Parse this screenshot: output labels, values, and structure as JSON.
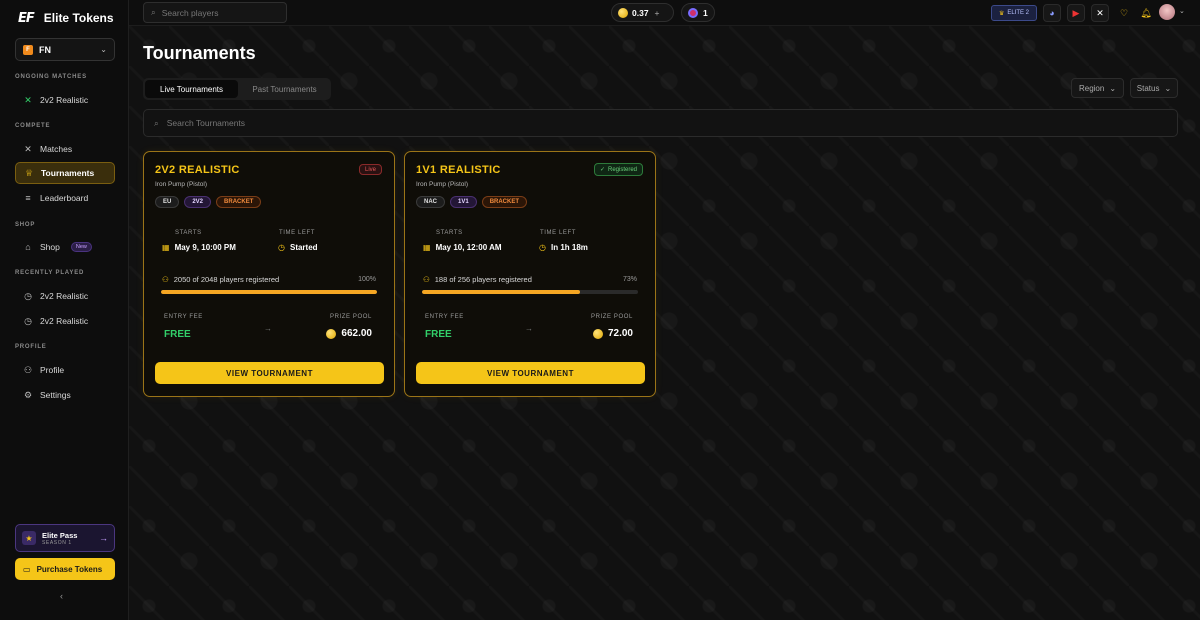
{
  "brand": {
    "logo": "EF",
    "name": "Elite Tokens"
  },
  "game_select": {
    "badge": "FN",
    "label": "FN"
  },
  "sidebar": {
    "sections": {
      "ongoing": "ONGOING MATCHES",
      "compete": "COMPETE",
      "shop": "SHOP",
      "recent": "RECENTLY PLAYED",
      "profile": "PROFILE"
    },
    "ongoing_items": [
      {
        "label": "2v2 Realistic",
        "icon": "crossed-swords-icon"
      }
    ],
    "compete_items": [
      {
        "label": "Matches",
        "icon": "crossed-swords-icon"
      },
      {
        "label": "Tournaments",
        "icon": "trophy-icon"
      },
      {
        "label": "Leaderboard",
        "icon": "list-icon"
      }
    ],
    "shop_item": {
      "label": "Shop",
      "tag": "New",
      "icon": "bag-icon"
    },
    "recent_items": [
      {
        "label": "2v2 Realistic",
        "icon": "clock-icon"
      },
      {
        "label": "2v2 Realistic",
        "icon": "clock-icon"
      }
    ],
    "profile_items": [
      {
        "label": "Profile",
        "icon": "user-icon"
      },
      {
        "label": "Settings",
        "icon": "gear-icon"
      }
    ],
    "elite_pass": {
      "title": "Elite Pass",
      "subtitle": "SEASON 1"
    },
    "purchase_label": "Purchase Tokens"
  },
  "topbar": {
    "search_placeholder": "Search players",
    "coins": "0.37",
    "tokens": "1",
    "elite_badge": "ELITE 2"
  },
  "main": {
    "title": "Tournaments",
    "tabs": [
      "Live Tournaments",
      "Past Tournaments"
    ],
    "filters": [
      "Region",
      "Status"
    ],
    "search_placeholder": "Search Tournaments"
  },
  "tournaments": [
    {
      "title": "2V2 REALISTIC",
      "subtitle": "Iron Pump (Pistol)",
      "status": "Live",
      "chips": [
        "EU",
        "2V2",
        "BRACKET"
      ],
      "starts_label": "STARTS",
      "starts": "May 9, 10:00 PM",
      "time_left_label": "TIME LEFT",
      "time_left": "Started",
      "registered_text": "2050 of 2048 players registered",
      "percent": "100%",
      "fill": 1.0,
      "entry_label": "ENTRY FEE",
      "entry_fee": "FREE",
      "prize_label": "PRIZE POOL",
      "prize": "662.00",
      "button": "VIEW TOURNAMENT"
    },
    {
      "title": "1V1 REALISTIC",
      "subtitle": "Iron Pump (Pistol)",
      "status": "Registered",
      "chips": [
        "NAC",
        "1V1",
        "BRACKET"
      ],
      "starts_label": "STARTS",
      "starts": "May 10, 12:00 AM",
      "time_left_label": "TIME LEFT",
      "time_left": "In 1h 18m",
      "registered_text": "188 of 256 players registered",
      "percent": "73%",
      "fill": 0.73,
      "entry_label": "ENTRY FEE",
      "entry_fee": "FREE",
      "prize_label": "PRIZE POOL",
      "prize": "72.00",
      "button": "VIEW TOURNAMENT"
    }
  ],
  "colors": {
    "accent": "#f5c518",
    "free": "#32d06a",
    "live": "#e55858",
    "registered": "#6ad07a"
  }
}
